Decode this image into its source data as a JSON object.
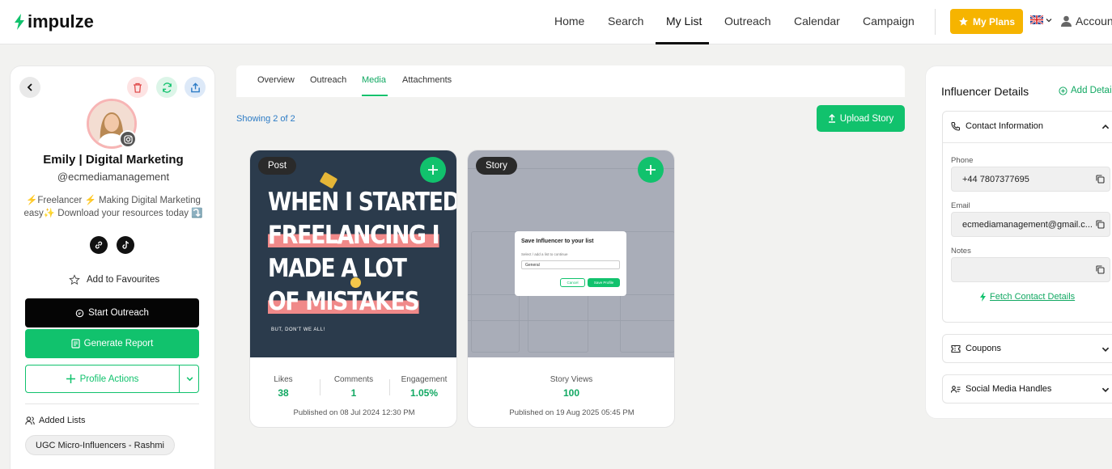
{
  "nav": {
    "brand": "impulze",
    "items": [
      "Home",
      "Search",
      "My List",
      "Outreach",
      "Calendar",
      "Campaign"
    ],
    "active": "My List",
    "plans_label": "My Plans",
    "account_label": "Account"
  },
  "profile": {
    "name": "Emily | Digital Marketing",
    "handle": "@ecmediamanagement",
    "bio": "⚡Freelancer ⚡ Making Digital Marketing easy✨ Download your resources today ⤵️",
    "favourites_label": "Add to Favourites",
    "start_outreach_label": "Start Outreach",
    "generate_report_label": "Generate Report",
    "profile_actions_label": "Profile Actions",
    "added_lists_title": "Added Lists",
    "lists": [
      "UGC Micro-Influencers - Rashmi"
    ]
  },
  "media": {
    "tabs": [
      "Overview",
      "Outreach",
      "Media",
      "Attachments"
    ],
    "active_tab": "Media",
    "showing_text": "Showing 2 of 2",
    "upload_label": "Upload Story",
    "cards": [
      {
        "type": "Post",
        "headline": [
          "WHEN I STARTED",
          "FREELANCING I",
          "MADE A LOT",
          "OF MISTAKES"
        ],
        "tagline": "BUT, DON'T WE ALL!",
        "likes_label": "Likes",
        "likes": "38",
        "comments_label": "Comments",
        "comments": "1",
        "engagement_label": "Engagement",
        "engagement": "1.05%",
        "published": "Published on 08 Jul 2024 12:30 PM"
      },
      {
        "type": "Story",
        "views_label": "Story Views",
        "views": "100",
        "published": "Published on 19 Aug 2025 05:45 PM",
        "inner_dialog_title": "Save Influencer to your list",
        "inner_dialog_hint": "Select / add a list to continue",
        "inner_dialog_select": "General",
        "inner_dialog_cancel": "Cancel",
        "inner_dialog_save": "Save Profile"
      }
    ]
  },
  "details": {
    "title": "Influencer Details",
    "add_label": "Add Detail",
    "contact_title": "Contact Information",
    "phone_label": "Phone",
    "phone": "+44 7807377695",
    "email_label": "Email",
    "email": "ecmediamanagement@gmail.c...",
    "notes_label": "Notes",
    "notes": "",
    "fetch_label": "Fetch Contact Details",
    "coupons_title": "Coupons",
    "social_title": "Social Media Handles"
  },
  "colors": {
    "accent": "#11c26d",
    "plans": "#f6b400",
    "danger": "#e04b4b"
  }
}
